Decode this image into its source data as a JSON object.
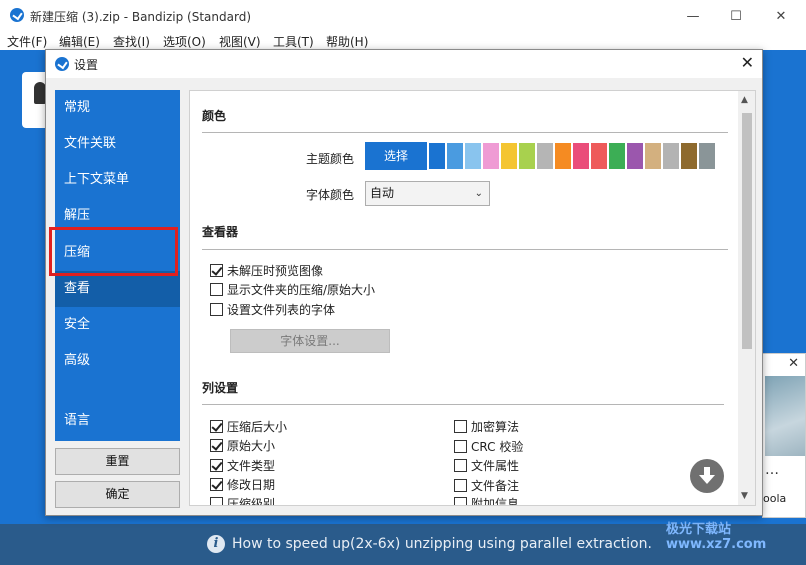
{
  "window": {
    "title": "新建压缩 (3).zip - Bandizip (Standard)",
    "minimize_glyph": "—",
    "maximize_glyph": "☐",
    "close_glyph": "✕"
  },
  "menubar": [
    "文件(F)",
    "编辑(E)",
    "查找(I)",
    "选项(O)",
    "视图(V)",
    "工具(T)",
    "帮助(H)"
  ],
  "dialog": {
    "title": "设置",
    "close_glyph": "✕",
    "nav": [
      "常规",
      "文件关联",
      "上下文菜单",
      "解压",
      "压缩",
      "查看",
      "安全",
      "高级",
      "语言"
    ],
    "active_nav": "查看",
    "reset_label": "重置",
    "ok_label": "确定"
  },
  "content": {
    "color_section": "颜色",
    "theme_color_label": "主题颜色",
    "choose_label": "选择",
    "swatches": [
      "#1a73d1",
      "#4a9be0",
      "#89c4ee",
      "#ef9bd4",
      "#f4c531",
      "#a8d14e",
      "#b5b5b5",
      "#f58b22",
      "#ea4d7a",
      "#ee5a5a",
      "#3cae55",
      "#9b57ad",
      "#d3b07f",
      "#b3b3b3",
      "#8e6a2e",
      "#8a9598"
    ],
    "font_color_label": "字体颜色",
    "font_color_value": "自动",
    "viewer_section": "查看器",
    "viewer_options": [
      {
        "label": "未解压时预览图像",
        "checked": true
      },
      {
        "label": "显示文件夹的压缩/原始大小",
        "checked": false
      },
      {
        "label": "设置文件列表的字体",
        "checked": false
      }
    ],
    "font_settings_label": "字体设置...",
    "columns_section": "列设置",
    "columns_left": [
      {
        "label": "压缩后大小",
        "checked": true
      },
      {
        "label": "原始大小",
        "checked": true
      },
      {
        "label": "文件类型",
        "checked": true
      },
      {
        "label": "修改日期",
        "checked": true
      },
      {
        "label": "压缩级别",
        "checked": false
      }
    ],
    "columns_right": [
      {
        "label": "加密算法",
        "checked": false
      },
      {
        "label": "CRC 校验",
        "checked": false
      },
      {
        "label": "文件属性",
        "checked": false
      },
      {
        "label": "文件备注",
        "checked": false
      },
      {
        "label": "附加信息",
        "checked": false
      }
    ]
  },
  "ad": {
    "close_glyph": "✕",
    "dots": "…",
    "text": "oola"
  },
  "status": {
    "info_glyph": "i",
    "text": "How to speed up(2x-6x) unzipping using parallel extraction."
  },
  "watermark": "极光下载站 www.xz7.com"
}
